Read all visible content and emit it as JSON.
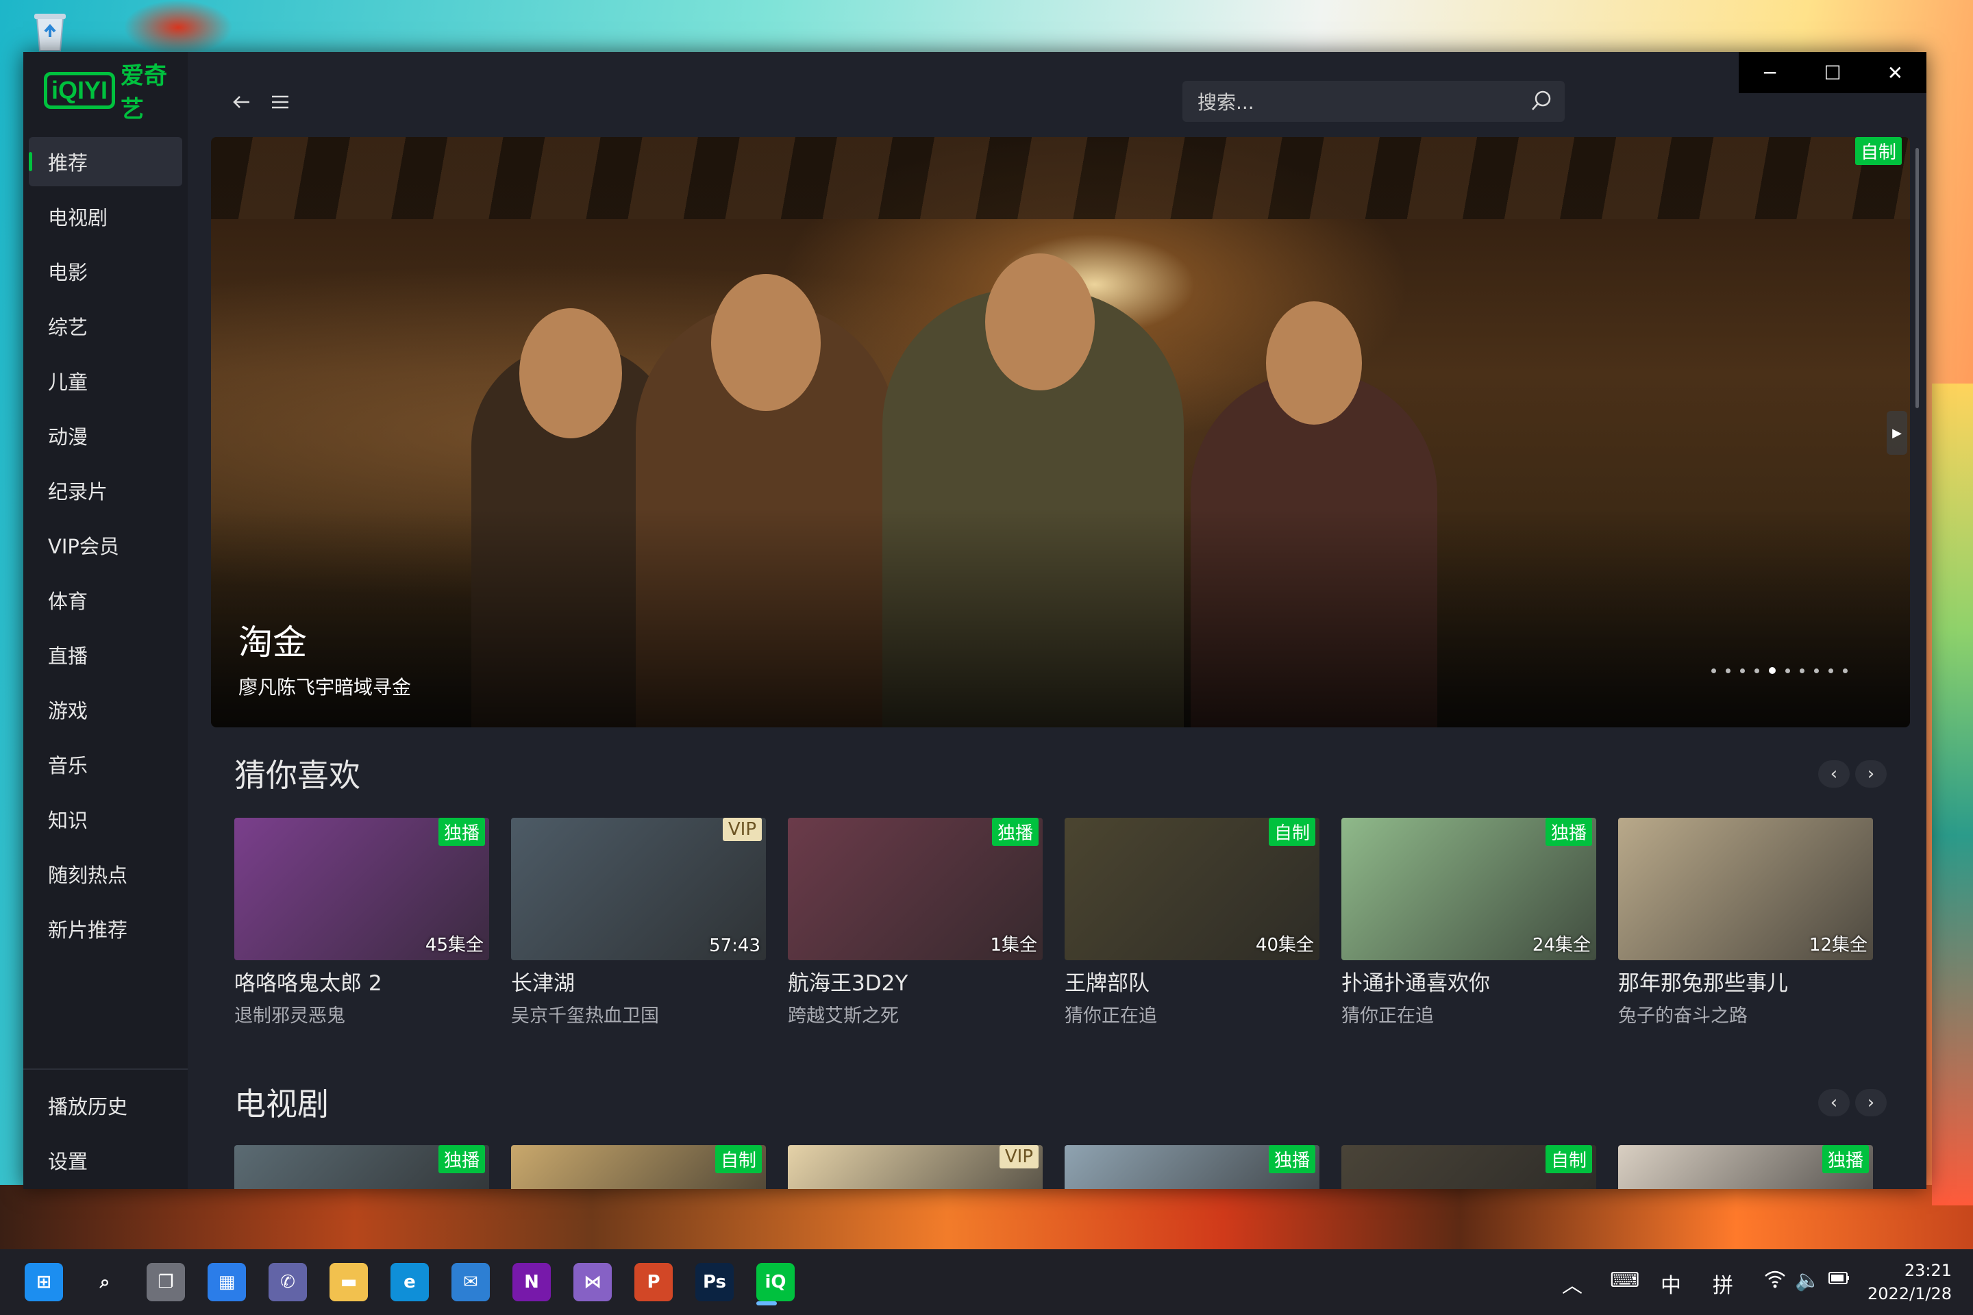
{
  "app": {
    "logo_mark": "iQIYI",
    "logo_text": "爱奇艺"
  },
  "sidebar": {
    "items": [
      {
        "label": "推荐",
        "active": true
      },
      {
        "label": "电视剧"
      },
      {
        "label": "电影"
      },
      {
        "label": "综艺"
      },
      {
        "label": "儿童"
      },
      {
        "label": "动漫"
      },
      {
        "label": "纪录片"
      },
      {
        "label": "VIP会员"
      },
      {
        "label": "体育"
      },
      {
        "label": "直播"
      },
      {
        "label": "游戏"
      },
      {
        "label": "音乐"
      },
      {
        "label": "知识"
      },
      {
        "label": "随刻热点"
      },
      {
        "label": "新片推荐"
      }
    ],
    "bottom_items": [
      {
        "label": "播放历史"
      },
      {
        "label": "设置"
      }
    ]
  },
  "topbar": {
    "back_icon": "arrow-left-icon",
    "menu_icon": "hamburger-icon",
    "search_placeholder": "搜索..."
  },
  "window_controls": {
    "minimize": "─",
    "maximize": "☐",
    "close": "✕"
  },
  "hero": {
    "title": "淘金",
    "subtitle": "廖凡陈飞宇暗域寻金",
    "badge": "自制",
    "dots_total": 10,
    "active_dot": 4
  },
  "sections": [
    {
      "title": "猜你喜欢",
      "cards": [
        {
          "title": "咯咯咯鬼太郎 2",
          "subtitle": "退制邪灵恶鬼",
          "badge": "独播",
          "badge_type": "green",
          "overlay": "45集全",
          "thumb_color": "#7a3f8c"
        },
        {
          "title": "长津湖",
          "subtitle": "吴京千玺热血卫国",
          "badge": "VIP",
          "badge_type": "vip",
          "overlay": "57:43",
          "thumb_color": "#4d5b66"
        },
        {
          "title": "航海王3D2Y",
          "subtitle": "跨越艾斯之死",
          "badge": "独播",
          "badge_type": "green",
          "overlay": "1集全",
          "thumb_color": "#6b3b4a"
        },
        {
          "title": "王牌部队",
          "subtitle": "猜你正在追",
          "badge": "自制",
          "badge_type": "green",
          "overlay": "40集全",
          "thumb_color": "#4b4530"
        },
        {
          "title": "扑通扑通喜欢你",
          "subtitle": "猜你正在追",
          "badge": "独播",
          "badge_type": "green",
          "overlay": "24集全",
          "thumb_color": "#8fb98a"
        },
        {
          "title": "那年那兔那些事儿",
          "subtitle": "兔子的奋斗之路",
          "badge": "",
          "badge_type": "none",
          "overlay": "12集全",
          "thumb_color": "#b9a98a"
        }
      ]
    },
    {
      "title": "电视剧",
      "cards": [
        {
          "badge": "独播",
          "badge_type": "green",
          "thumb_color": "#5b6b73"
        },
        {
          "badge": "自制",
          "badge_type": "green",
          "thumb_color": "#c9a86c"
        },
        {
          "badge": "VIP",
          "badge_type": "vip",
          "thumb_color": "#e5d2a8"
        },
        {
          "badge": "独播",
          "badge_type": "green",
          "thumb_color": "#8fa3b1"
        },
        {
          "badge": "自制",
          "badge_type": "green",
          "thumb_color": "#4a4438"
        },
        {
          "badge": "独播",
          "badge_type": "green",
          "thumb_color": "#d9cfc2"
        }
      ]
    }
  ],
  "section_nav": {
    "prev": "‹",
    "next": "›"
  },
  "taskbar": {
    "apps": [
      "start-icon",
      "search-icon",
      "task-view-icon",
      "widgets-icon",
      "teams-chat-icon",
      "file-explorer-icon",
      "edge-icon",
      "mail-icon",
      "onenote-icon",
      "visual-studio-icon",
      "powerpoint-icon",
      "photoshop-icon",
      "iqiyi-icon"
    ],
    "tray": {
      "ime_mode": "中",
      "ime_input": "拼"
    },
    "time": "23:21",
    "date": "2022/1/28"
  }
}
